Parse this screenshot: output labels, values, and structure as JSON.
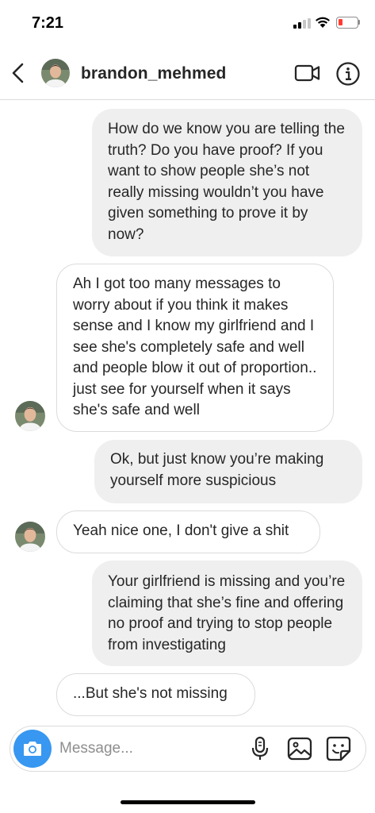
{
  "status_bar": {
    "time": "7:21"
  },
  "header": {
    "username": "brandon_mehmed",
    "back_icon": "chevron-left-icon",
    "video_icon": "video-camera-icon",
    "info_icon": "info-icon"
  },
  "messages": [
    {
      "direction": "sent",
      "text": "How do we know you are telling the truth? Do you have proof? If you want to show people she’s not really missing wouldn’t you have given something to prove it by now?"
    },
    {
      "direction": "received",
      "text": "Ah I got too many messages to worry about if you think it makes sense and I know my girlfriend and I see she's completely safe and well and people blow it out of proportion.. just see for yourself when it says she's safe and well"
    },
    {
      "direction": "sent",
      "text": "Ok, but just know you’re making yourself more suspicious"
    },
    {
      "direction": "received",
      "text": "Yeah nice one, I don't give a shit"
    },
    {
      "direction": "sent",
      "text": "Your girlfriend is missing and you’re claiming that she’s fine and offering no proof and trying to stop people from investigating"
    },
    {
      "direction": "received",
      "text": "...But she's not missing"
    }
  ],
  "composer": {
    "placeholder": "Message...",
    "camera_icon": "camera-icon",
    "mic_icon": "microphone-icon",
    "gallery_icon": "gallery-icon",
    "sticker_icon": "sticker-icon"
  },
  "colors": {
    "accent_blue": "#3897f0",
    "sent_bubble": "#efefef",
    "border": "#dbdbdb",
    "text": "#262626",
    "placeholder": "#8e8e8e",
    "battery_low": "#ff3b30"
  }
}
